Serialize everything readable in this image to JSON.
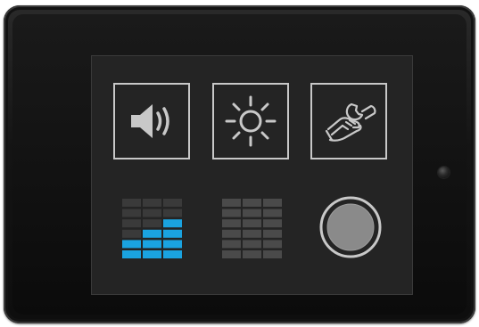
{
  "device": {
    "frame_color": "#141414",
    "screen_color": "#242424"
  },
  "tiles": [
    {
      "id": "volume",
      "icon": "speaker-icon",
      "color": "#c8c8c8"
    },
    {
      "id": "brightness",
      "icon": "sun-icon",
      "color": "#c8c8c8"
    },
    {
      "id": "settings",
      "icon": "wrench-hand-icon",
      "color": "#c8c8c8"
    }
  ],
  "controls": {
    "level_meter_active": {
      "icon": "equalizer-bars-icon",
      "accent": "#1aa3e0",
      "levels": [
        2,
        3,
        4
      ],
      "max": 6
    },
    "level_meter_inactive": {
      "icon": "equalizer-grid-icon",
      "color": "#4a4a4a",
      "levels": [
        0,
        0,
        0
      ],
      "max": 6
    },
    "round_button": {
      "icon": "circle-button-icon",
      "color": "#8a8a8a"
    }
  }
}
